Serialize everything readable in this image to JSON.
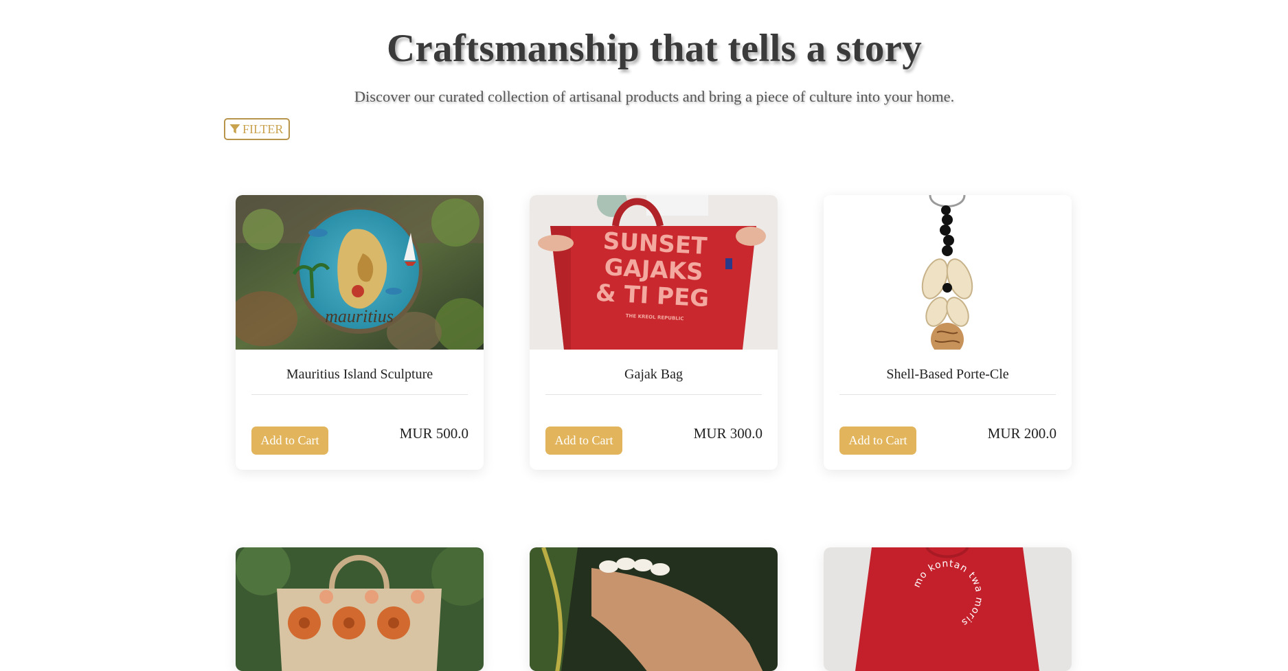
{
  "hero": {
    "title": "Craftsmanship that tells a story",
    "subtitle": "Discover our curated collection of artisanal products and bring a piece of culture into your home."
  },
  "filter": {
    "label": "FILTER",
    "icon": "funnel-icon"
  },
  "products": [
    {
      "name": "Mauritius Island Sculpture",
      "price": "MUR 500.0",
      "cta": "Add to Cart",
      "image_text": "mauritius"
    },
    {
      "name": "Gajak Bag",
      "price": "MUR 300.0",
      "cta": "Add to Cart",
      "image_text": [
        "SUNSET",
        "GAJAKS",
        "& TI PEG",
        "THE KREOL REPUBLIC"
      ]
    },
    {
      "name": "Shell-Based Porte-Cle",
      "price": "MUR 200.0",
      "cta": "Add to Cart"
    },
    {
      "name": "",
      "price": "",
      "cta": ""
    },
    {
      "name": "",
      "price": "",
      "cta": ""
    },
    {
      "name": "",
      "price": "",
      "cta": "",
      "image_text": "mo kontan twa moris"
    }
  ],
  "colors": {
    "accent": "#e2b55c",
    "filter_border": "#b8944a",
    "filter_text": "#c9a24e",
    "title": "#3a3a3a"
  }
}
